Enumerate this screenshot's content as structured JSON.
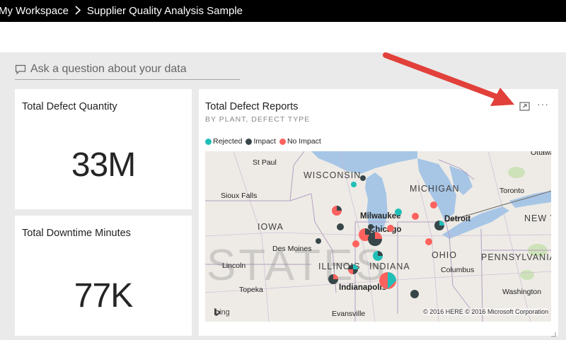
{
  "header": {
    "breadcrumb": [
      "My Workspace",
      "Supplier Quality Analysis Sample"
    ]
  },
  "qa": {
    "placeholder": "Ask a question about your data"
  },
  "tiles": {
    "defect_quantity": {
      "title": "Total Defect Quantity",
      "value": "33M"
    },
    "downtime": {
      "title": "Total Downtime Minutes",
      "value": "77K"
    },
    "defect_reports": {
      "title": "Total Defect Reports",
      "subtitle": "BY PLANT, DEFECT TYPE",
      "legend": [
        {
          "label": "Rejected",
          "color": "#1fbfb8"
        },
        {
          "label": "Impact",
          "color": "#374649"
        },
        {
          "label": "No Impact",
          "color": "#fd625e"
        }
      ],
      "map": {
        "states": [
          "WISCONSIN",
          "MICHIGAN",
          "IOWA",
          "ILLINOIS",
          "INDIANA",
          "OHIO",
          "PENNSYLVANIA",
          "NEW YO"
        ],
        "cities": [
          "St Paul",
          "Sioux Falls",
          "Milwaukee",
          "Chicago",
          "Detroit",
          "Toronto",
          "Ottawa",
          "Des Moines",
          "Lincoln",
          "Topeka",
          "Indianapolis",
          "Columbus",
          "Washington",
          "Evansville"
        ],
        "watermark": "STATES",
        "provider": "bing",
        "copyright": "© 2016 HERE © 2016 Microsoft Corporation"
      }
    }
  },
  "colors": {
    "rejected": "#1fbfb8",
    "impact": "#374649",
    "no_impact": "#fd625e",
    "topbar": "#000000",
    "canvas": "#eaeaea",
    "annotation_arrow": "#e2403a"
  },
  "icons": [
    "chat-bubble-icon",
    "focus-mode-icon",
    "more-options-icon",
    "resize-grip-icon",
    "bing-logo-icon"
  ]
}
